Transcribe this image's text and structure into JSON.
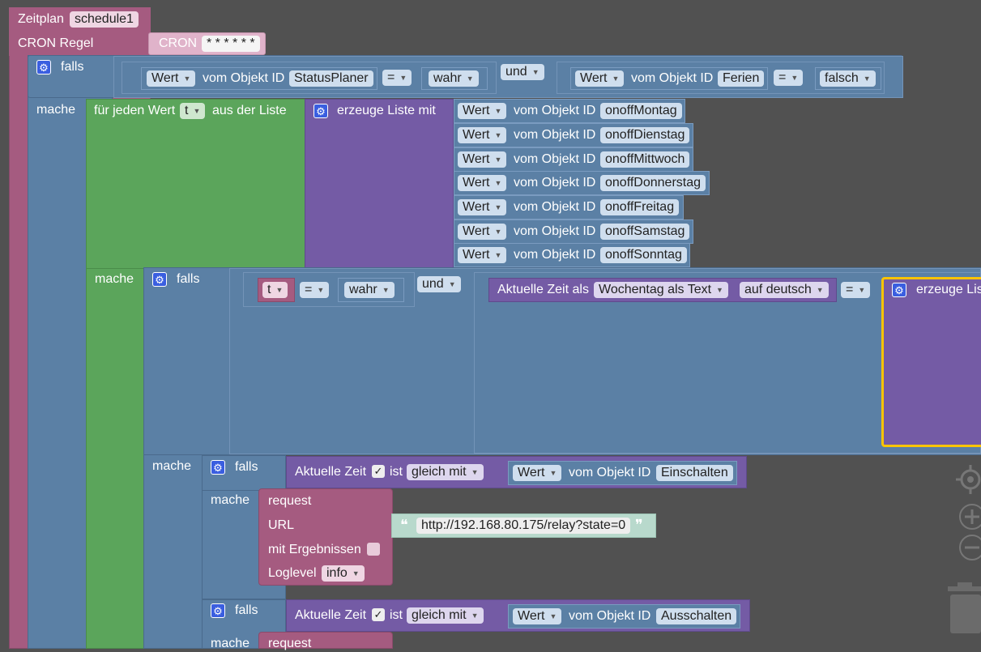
{
  "schedule": {
    "label": "Zeitplan",
    "name": "schedule1",
    "cron_label": "CRON Regel",
    "cron_block": "CRON",
    "cron_value": "* * * * * *"
  },
  "if1": {
    "falls": "falls",
    "mache": "mache",
    "left": {
      "prop": "Wert",
      "of": "vom Objekt ID",
      "id": "StatusPlaner"
    },
    "op1": "=",
    "val1": "wahr",
    "and": "und",
    "right": {
      "prop": "Wert",
      "of": "vom Objekt ID",
      "id": "Ferien"
    },
    "op2": "=",
    "val2": "falsch"
  },
  "foreach": {
    "prefix": "für jeden Wert",
    "var": "t",
    "suffix": "aus der Liste",
    "mache": "mache",
    "list_label": "erzeuge Liste mit",
    "items": [
      {
        "prop": "Wert",
        "of": "vom Objekt ID",
        "id": "onoffMontag"
      },
      {
        "prop": "Wert",
        "of": "vom Objekt ID",
        "id": "onoffDienstag"
      },
      {
        "prop": "Wert",
        "of": "vom Objekt ID",
        "id": "onoffMittwoch"
      },
      {
        "prop": "Wert",
        "of": "vom Objekt ID",
        "id": "onoffDonnerstag"
      },
      {
        "prop": "Wert",
        "of": "vom Objekt ID",
        "id": "onoffFreitag"
      },
      {
        "prop": "Wert",
        "of": "vom Objekt ID",
        "id": "onoffSamstag"
      },
      {
        "prop": "Wert",
        "of": "vom Objekt ID",
        "id": "onoffSonntag"
      }
    ]
  },
  "if2": {
    "falls": "falls",
    "mache": "mache",
    "var": "t",
    "op": "=",
    "val": "wahr",
    "and": "und",
    "time_label": "Aktuelle Zeit als",
    "time_format": "Wochentag als Text",
    "time_lang": "auf deutsch",
    "op2": "=",
    "list_label": "erzeuge Lis"
  },
  "if3": {
    "falls": "falls",
    "mache": "mache",
    "time": "Aktuelle Zeit",
    "check": "✓",
    "ist": "ist",
    "cmp": "gleich mit",
    "prop": "Wert",
    "of": "vom Objekt ID",
    "id": "Einschalten"
  },
  "request1": {
    "label": "request",
    "url_label": "URL",
    "url": "http://192.168.80.175/relay?state=0",
    "results_label": "mit Ergebnissen",
    "loglevel_label": "Loglevel",
    "loglevel": "info"
  },
  "if4": {
    "falls": "falls",
    "mache": "mache",
    "time": "Aktuelle Zeit",
    "check": "✓",
    "ist": "ist",
    "cmp": "gleich mit",
    "prop": "Wert",
    "of": "vom Objekt ID",
    "id": "Ausschalten"
  },
  "request2": {
    "label": "request"
  },
  "quote_open": "❝",
  "quote_close": "❞",
  "colors": {
    "workspace": "#515151",
    "pink": "#a55b80",
    "steel": "#5b80a5",
    "green": "#5ba55b",
    "purple": "#745ba5",
    "teal": "#5ba58c",
    "highlight": "#fcc400"
  },
  "icons": [
    "gear-icon",
    "dropdown-arrow-icon",
    "recenter-icon",
    "zoom-in-icon",
    "zoom-out-icon",
    "trash-icon"
  ]
}
